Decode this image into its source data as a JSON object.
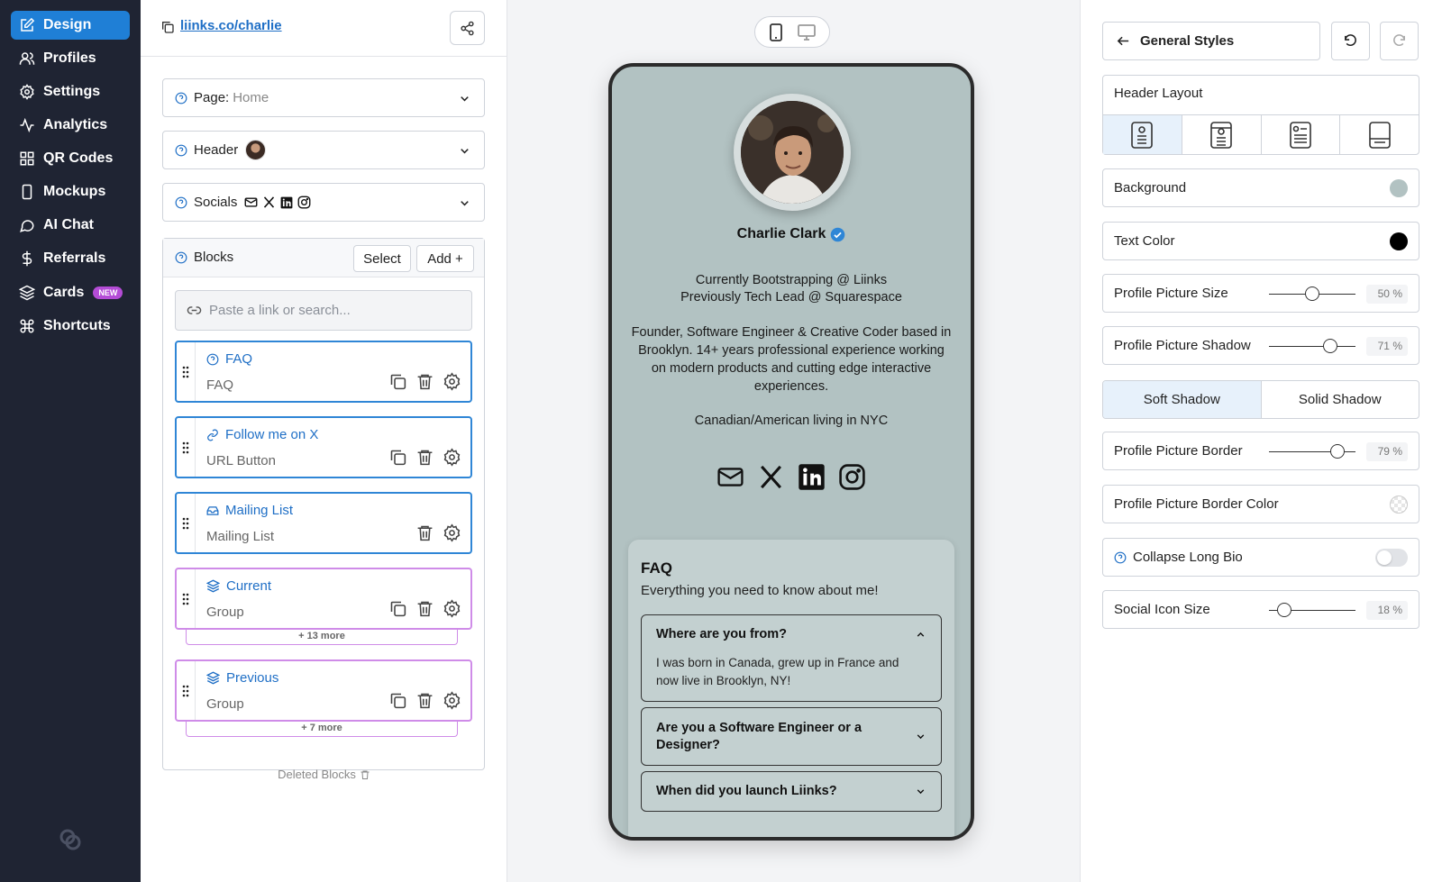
{
  "colors": {
    "sidebar_bg": "#1f2433",
    "accent": "#1f7fd6",
    "link": "#1f6fc6",
    "group_border": "#cf8ce8",
    "preview_bg": "#b2c2c2",
    "text_color": "#000000"
  },
  "sidebar": {
    "items": [
      {
        "label": "Design",
        "icon": "edit-icon",
        "active": true
      },
      {
        "label": "Profiles",
        "icon": "users-icon"
      },
      {
        "label": "Settings",
        "icon": "gear-icon"
      },
      {
        "label": "Analytics",
        "icon": "activity-icon"
      },
      {
        "label": "QR Codes",
        "icon": "grid-icon"
      },
      {
        "label": "Mockups",
        "icon": "phone-icon"
      },
      {
        "label": "AI Chat",
        "icon": "chat-icon"
      },
      {
        "label": "Referrals",
        "icon": "dollar-icon"
      },
      {
        "label": "Cards",
        "icon": "layers-icon",
        "badge": "NEW"
      },
      {
        "label": "Shortcuts",
        "icon": "command-icon"
      }
    ]
  },
  "editor": {
    "url": "liinks.co/charlie",
    "page_label": "Page:",
    "page_value": "Home",
    "header_label": "Header",
    "socials_label": "Socials",
    "blocks_label": "Blocks",
    "select_label": "Select",
    "add_label": "Add +",
    "search_placeholder": "Paste a link or search...",
    "blocks": [
      {
        "title": "FAQ",
        "subtitle": "FAQ",
        "icon": "help-circle-icon"
      },
      {
        "title": "Follow me on X",
        "subtitle": "URL Button",
        "icon": "link-icon"
      },
      {
        "title": "Mailing List",
        "subtitle": "Mailing List",
        "icon": "inbox-icon"
      },
      {
        "title": "Current",
        "subtitle": "Group",
        "icon": "layers-icon",
        "more": "+ 13 more"
      },
      {
        "title": "Previous",
        "subtitle": "Group",
        "icon": "layers-icon",
        "more": "+ 7 more"
      }
    ],
    "deleted_blocks": "Deleted Blocks"
  },
  "preview": {
    "name": "Charlie Clark",
    "bio_line1": "Currently Bootstrapping @ Liinks",
    "bio_line2": "Previously Tech Lead @ Squarespace",
    "bio_para": "Founder, Software Engineer & Creative Coder based in Brooklyn. 14+ years professional experience working on modern products and cutting edge interactive experiences.",
    "bio_location": "Canadian/American living in NYC",
    "socials": [
      "mail-icon",
      "x-icon",
      "linkedin-icon",
      "instagram-icon"
    ],
    "faq": {
      "title": "FAQ",
      "subtitle": "Everything you need to know about me!",
      "items": [
        {
          "q": "Where are you from?",
          "a": "I was born in Canada, grew up in France and now live in Brooklyn, NY!",
          "open": true
        },
        {
          "q": "Are you a Software Engineer or a Designer?",
          "open": false
        },
        {
          "q": "When did you launch Liinks?",
          "open": false
        }
      ]
    }
  },
  "styles": {
    "title": "General Styles",
    "header_layout": "Header Layout",
    "background": {
      "label": "Background",
      "color": "#b2c2c2"
    },
    "text_color": {
      "label": "Text Color",
      "color": "#000000"
    },
    "picture_size": {
      "label": "Profile Picture Size",
      "value": 50,
      "display": "50"
    },
    "picture_shadow": {
      "label": "Profile Picture Shadow",
      "value": 71,
      "display": "71"
    },
    "soft_shadow": "Soft Shadow",
    "solid_shadow": "Solid Shadow",
    "picture_border": {
      "label": "Profile Picture Border",
      "value": 79,
      "display": "79"
    },
    "border_color": {
      "label": "Profile Picture Border Color"
    },
    "collapse_bio": {
      "label": "Collapse Long Bio",
      "enabled": false
    },
    "social_icon_size": {
      "label": "Social Icon Size",
      "value": 18,
      "display": "18"
    },
    "percent_sign": "%"
  }
}
